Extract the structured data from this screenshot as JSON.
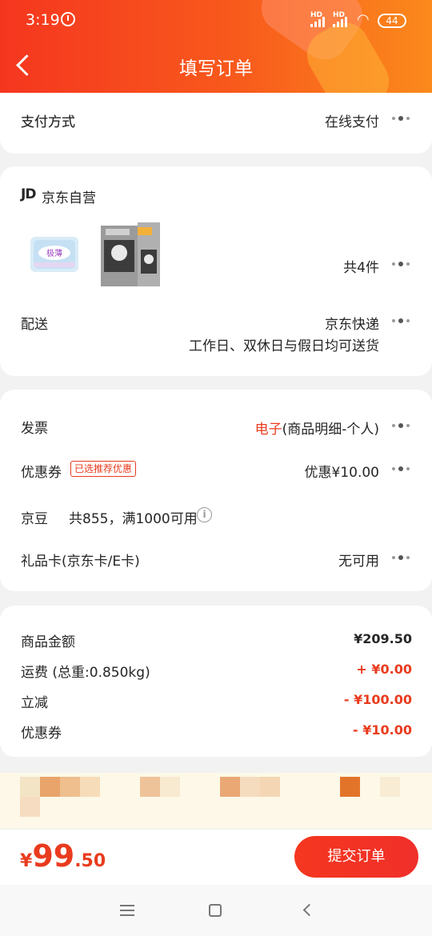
{
  "status_bar": {
    "time": "3:19",
    "signal1": "HD",
    "signal2": "HD",
    "battery": "44"
  },
  "header": {
    "title": "填写订单"
  },
  "payment": {
    "label": "支付方式",
    "value": "在线支付"
  },
  "shop": {
    "logo": "JD",
    "name": "京东自营",
    "products_count": "共4件",
    "delivery_label": "配送",
    "delivery_value": "京东快递",
    "delivery_note": "工作日、双休日与假日均可送货"
  },
  "invoice": {
    "label": "发票",
    "type": "电子",
    "detail": "(商品明细-个人)"
  },
  "coupon": {
    "label": "优惠券",
    "tag": "已选推荐优惠",
    "value": "优惠¥10.00"
  },
  "jingdou": {
    "label": "京豆",
    "text": "共855，满1000可用",
    "info_icon": "i"
  },
  "giftcard": {
    "label": "礼品卡(京东卡/E卡)",
    "value": "无可用"
  },
  "summary": {
    "goods_label": "商品金额",
    "goods_value": "¥209.50",
    "shipping_label": "运费 (总重:0.850kg)",
    "shipping_value": "+ ¥0.00",
    "discount_label": "立减",
    "discount_value": "- ¥100.00",
    "coupon_label": "优惠券",
    "coupon_value": "- ¥10.00"
  },
  "bottom": {
    "currency": "¥",
    "price_int": "99",
    "price_dec": ".50",
    "submit_label": "提交订单"
  },
  "colors": {
    "accent": "#e93b1e",
    "header_start": "#f5361f",
    "header_end": "#fb8a1c"
  }
}
